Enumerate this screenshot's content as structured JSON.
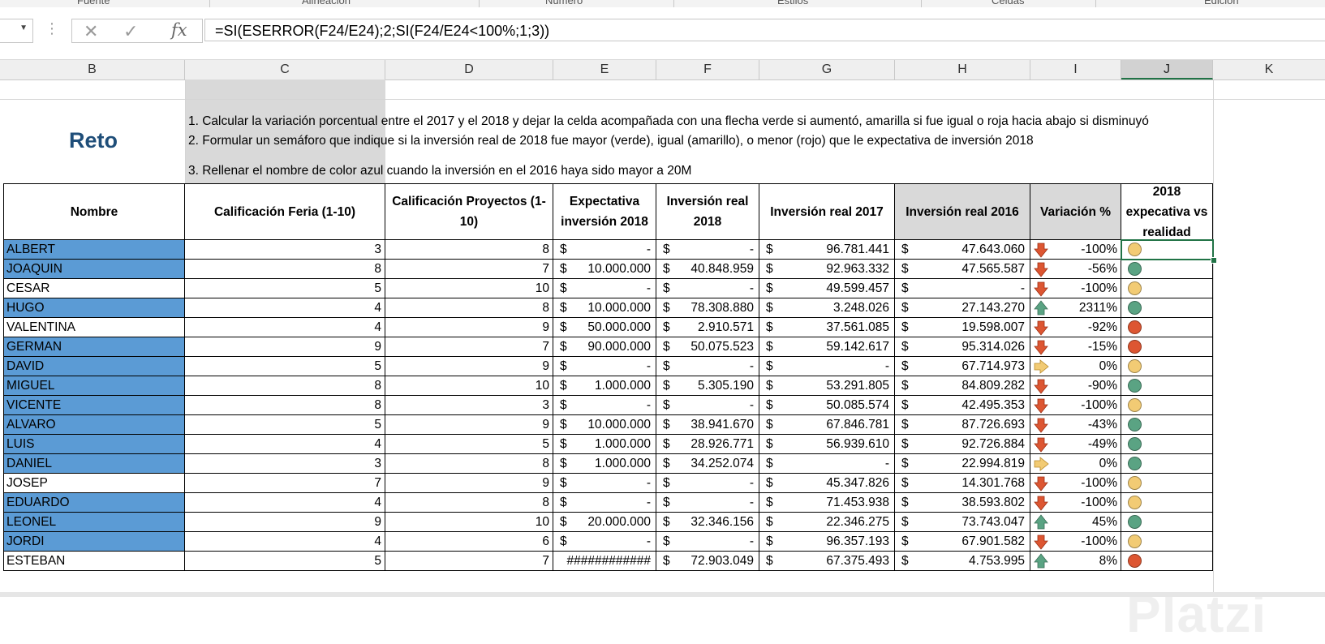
{
  "ribbon": {
    "groups": [
      "Fuente",
      "Alineación",
      "Número",
      "Estilos",
      "Celdas",
      "Edición"
    ]
  },
  "formula_bar": {
    "name_box": "",
    "cancel_icon": "✕",
    "enter_icon": "✓",
    "fx_label": "fx",
    "formula": "=SI(ESERROR(F24/E24);2;SI(F24/E24<100%;1;3))"
  },
  "columns": [
    "B",
    "C",
    "D",
    "E",
    "F",
    "G",
    "H",
    "I",
    "J",
    "K"
  ],
  "selected_column": "J",
  "sheet": {
    "title": "Reto",
    "instructions": [
      "1. Calcular la variación porcentual entre el 2017  y el 2018 y dejar la celda acompañada con una flecha verde si aumentó, amarilla si fue igual o roja hacia abajo si disminuyó",
      "2. Formular un semáforo que indique si la inversión real de 2018 fue mayor (verde), igual (amarillo), o menor (rojo) que le expectativa de inversión 2018",
      "3. Rellenar el nombre de color azul cuando la inversión en el 2016 haya sido mayor a 20M"
    ],
    "headers": [
      "Nombre",
      "Calificación Feria (1-10)",
      "Calificación Proyectos (1-10)",
      "Expectativa inversión 2018",
      "Inversión real 2018",
      "Inversión real 2017",
      "Inversión real 2016",
      "Variación %",
      "2018 expecativa vs realidad"
    ],
    "currency_symbol": "$",
    "colors": {
      "name_fill": "#5b9bd5",
      "header_gray": "#d9d9d9",
      "green": "#5aa383",
      "yellow": "#f2cb74",
      "red": "#dd5632",
      "selection": "#217346"
    },
    "rows": [
      {
        "name": "ALBERT",
        "blue": true,
        "feria": "3",
        "proyectos": "8",
        "exp2018": "-",
        "real2018": "-",
        "real2017": "96.781.441",
        "real2016": "47.643.060",
        "arrow": "down",
        "variation": "-100%",
        "light": "yellow"
      },
      {
        "name": "JOAQUIN",
        "blue": true,
        "feria": "8",
        "proyectos": "7",
        "exp2018": "10.000.000",
        "real2018": "40.848.959",
        "real2017": "92.963.332",
        "real2016": "47.565.587",
        "arrow": "down",
        "variation": "-56%",
        "light": "green"
      },
      {
        "name": "CESAR",
        "blue": false,
        "feria": "5",
        "proyectos": "10",
        "exp2018": "-",
        "real2018": "-",
        "real2017": "49.599.457",
        "real2016": "-",
        "arrow": "down",
        "variation": "-100%",
        "light": "yellow"
      },
      {
        "name": "HUGO",
        "blue": true,
        "feria": "4",
        "proyectos": "8",
        "exp2018": "10.000.000",
        "real2018": "78.308.880",
        "real2017": "3.248.026",
        "real2016": "27.143.270",
        "arrow": "up",
        "variation": "2311%",
        "light": "green"
      },
      {
        "name": "VALENTINA",
        "blue": false,
        "feria": "4",
        "proyectos": "9",
        "exp2018": "50.000.000",
        "real2018": "2.910.571",
        "real2017": "37.561.085",
        "real2016": "19.598.007",
        "arrow": "down",
        "variation": "-92%",
        "light": "red"
      },
      {
        "name": "GERMAN",
        "blue": true,
        "feria": "9",
        "proyectos": "7",
        "exp2018": "90.000.000",
        "real2018": "50.075.523",
        "real2017": "59.142.617",
        "real2016": "95.314.026",
        "arrow": "down",
        "variation": "-15%",
        "light": "red"
      },
      {
        "name": "DAVID",
        "blue": true,
        "feria": "5",
        "proyectos": "9",
        "exp2018": "-",
        "real2018": "-",
        "real2017": "-",
        "real2016": "67.714.973",
        "arrow": "right",
        "variation": "0%",
        "light": "yellow"
      },
      {
        "name": "MIGUEL",
        "blue": true,
        "feria": "8",
        "proyectos": "10",
        "exp2018": "1.000.000",
        "real2018": "5.305.190",
        "real2017": "53.291.805",
        "real2016": "84.809.282",
        "arrow": "down",
        "variation": "-90%",
        "light": "green"
      },
      {
        "name": "VICENTE",
        "blue": true,
        "feria": "8",
        "proyectos": "3",
        "exp2018": "-",
        "real2018": "-",
        "real2017": "50.085.574",
        "real2016": "42.495.353",
        "arrow": "down",
        "variation": "-100%",
        "light": "yellow"
      },
      {
        "name": "ALVARO",
        "blue": true,
        "feria": "5",
        "proyectos": "9",
        "exp2018": "10.000.000",
        "real2018": "38.941.670",
        "real2017": "67.846.781",
        "real2016": "87.726.693",
        "arrow": "down",
        "variation": "-43%",
        "light": "green"
      },
      {
        "name": "LUIS",
        "blue": true,
        "feria": "4",
        "proyectos": "5",
        "exp2018": "1.000.000",
        "real2018": "28.926.771",
        "real2017": "56.939.610",
        "real2016": "92.726.884",
        "arrow": "down",
        "variation": "-49%",
        "light": "green"
      },
      {
        "name": "DANIEL",
        "blue": true,
        "feria": "3",
        "proyectos": "8",
        "exp2018": "1.000.000",
        "real2018": "34.252.074",
        "real2017": "-",
        "real2016": "22.994.819",
        "arrow": "right",
        "variation": "0%",
        "light": "green"
      },
      {
        "name": "JOSEP",
        "blue": false,
        "feria": "7",
        "proyectos": "9",
        "exp2018": "-",
        "real2018": "-",
        "real2017": "45.347.826",
        "real2016": "14.301.768",
        "arrow": "down",
        "variation": "-100%",
        "light": "yellow"
      },
      {
        "name": "EDUARDO",
        "blue": true,
        "feria": "4",
        "proyectos": "8",
        "exp2018": "-",
        "real2018": "-",
        "real2017": "71.453.938",
        "real2016": "38.593.802",
        "arrow": "down",
        "variation": "-100%",
        "light": "yellow"
      },
      {
        "name": "LEONEL",
        "blue": true,
        "feria": "9",
        "proyectos": "10",
        "exp2018": "20.000.000",
        "real2018": "32.346.156",
        "real2017": "22.346.275",
        "real2016": "73.743.047",
        "arrow": "up",
        "variation": "45%",
        "light": "green"
      },
      {
        "name": "JORDI",
        "blue": true,
        "feria": "4",
        "proyectos": "6",
        "exp2018": "-",
        "real2018": "-",
        "real2017": "96.357.193",
        "real2016": "67.901.582",
        "arrow": "down",
        "variation": "-100%",
        "light": "yellow"
      },
      {
        "name": "ESTEBAN",
        "blue": false,
        "feria": "5",
        "proyectos": "7",
        "exp2018": "############",
        "real2018": "72.903.049",
        "real2017": "67.375.493",
        "real2016": "4.753.995",
        "arrow": "up",
        "variation": "8%",
        "light": "red"
      }
    ]
  },
  "watermark": "Platzi"
}
